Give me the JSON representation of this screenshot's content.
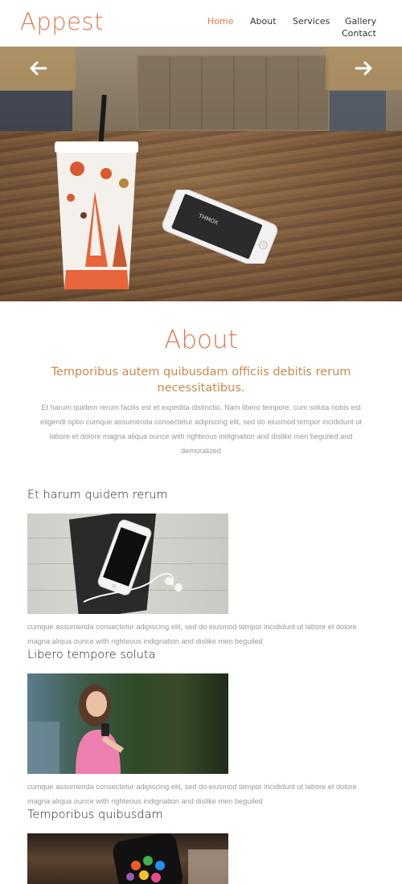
{
  "brand": {
    "logo": "Appest",
    "accent": "#e07a52",
    "subtitle_color": "#c9894e"
  },
  "nav": {
    "items": [
      {
        "label": "Home",
        "active": true
      },
      {
        "label": "Services",
        "active": false
      },
      {
        "label": "Gallery",
        "active": false
      },
      {
        "label": "About",
        "active": false
      },
      {
        "label": "Contact",
        "active": false
      }
    ]
  },
  "hero": {
    "prev_icon": "arrow-left-icon",
    "next_icon": "arrow-right-icon",
    "phone_brand": "THMOX"
  },
  "about": {
    "title": "About",
    "subtitle": "Temporibus autem quibusdam officiis debitis rerum necessitatibus.",
    "body": "Et harum quidem rerum facilis est et expedita distinctio. Nam libero tempore, cum soluta nobis est eligendi optio cumque assumenda consectetur adipiscing elit, sed do eiusmod tempor incididunt ut labore et dolore magna aliqua ounce with righteous indignation and dislike men beguiled and demoralized"
  },
  "sections": [
    {
      "title": "Et harum quidem rerum",
      "text": "cumque assumenda consectetur adipiscing elit, sed do eiusmod tempor incididunt ut labore et dolore magna aliqua ounce with righteous indignation and dislike men beguiled"
    },
    {
      "title": "Libero tempore soluta",
      "text": "cumque assumenda consectetur adipiscing elit, sed do eiusmod tempor incididunt ut labore et dolore magna aliqua ounce with righteous indignation and dislike men beguiled"
    },
    {
      "title": "Temporibus quibusdam",
      "text": ""
    }
  ]
}
